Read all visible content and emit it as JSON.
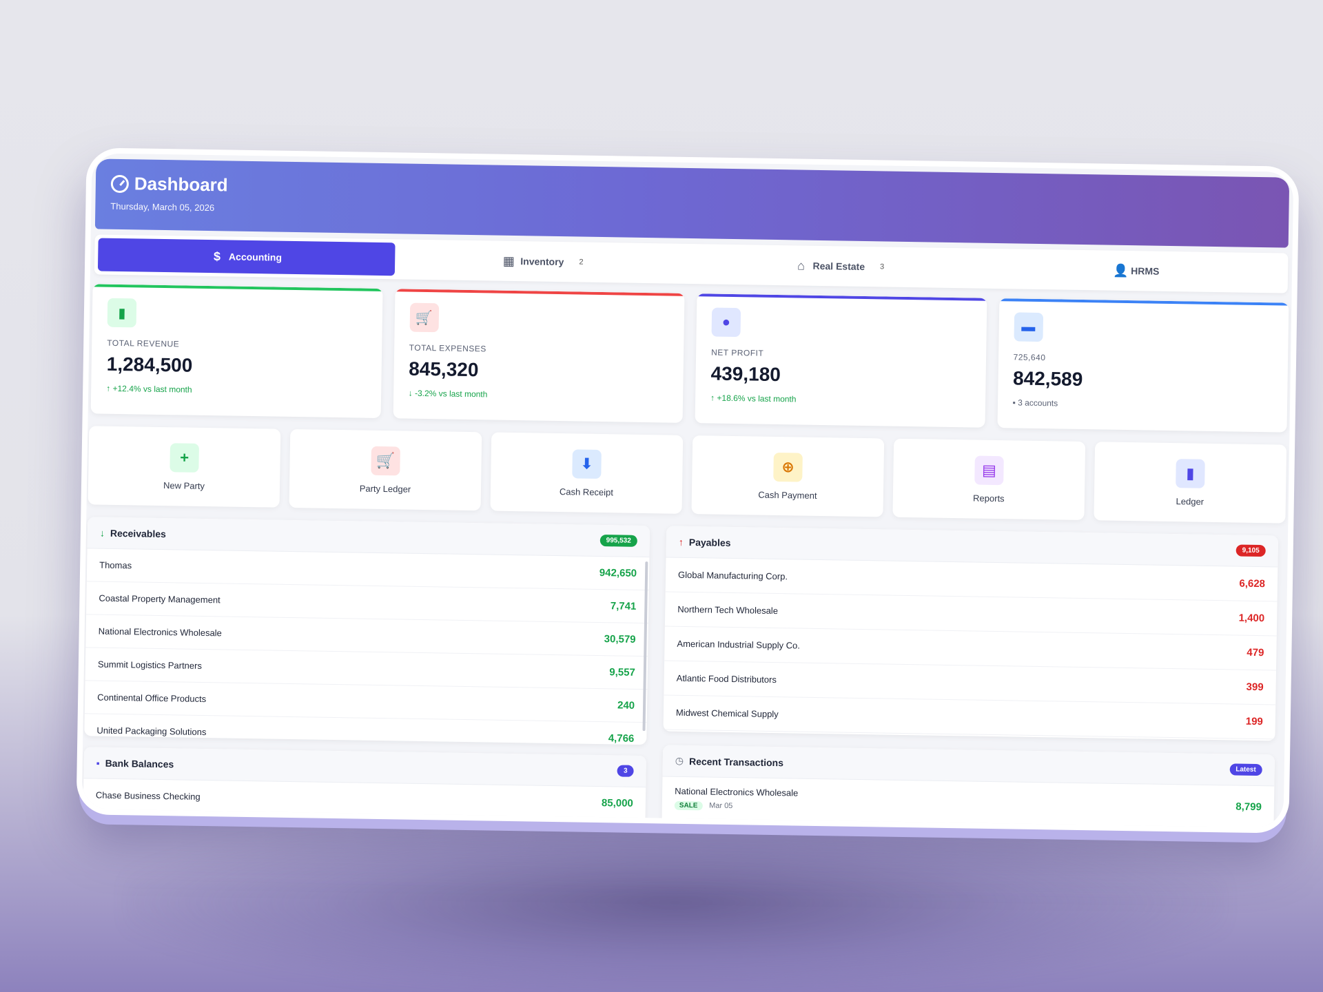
{
  "header": {
    "title": "Dashboard",
    "date": "Thursday, March 05, 2026"
  },
  "tabs": [
    {
      "label": "Accounting",
      "icon": "dollar-icon",
      "count": ""
    },
    {
      "label": "Inventory",
      "icon": "grid-icon",
      "count": "2"
    },
    {
      "label": "Real Estate",
      "icon": "home-icon",
      "count": "3"
    },
    {
      "label": "HRMS",
      "icon": "user-icon",
      "count": ""
    }
  ],
  "stats": [
    {
      "label": "TOTAL REVENUE",
      "value": "1,284,500",
      "trend": "+12.4% vs last month",
      "icon": "bar-chart-icon",
      "accent": "#22c55e"
    },
    {
      "label": "TOTAL EXPENSES",
      "value": "845,320",
      "trend": "-3.2% vs last month",
      "icon": "cart-icon",
      "accent": "#ef4444"
    },
    {
      "label": "NET PROFIT",
      "value": "439,180",
      "trend": "+18.6% vs last month",
      "icon": "piggy-bank-icon",
      "accent": "#4f46e5"
    },
    {
      "label": "725,640",
      "value": "842,589",
      "trend": "3 accounts",
      "icon": "credit-card-icon",
      "accent": "#3b82f6"
    }
  ],
  "actions": [
    {
      "label": "New Party",
      "icon": "plus-icon"
    },
    {
      "label": "Party Ledger",
      "icon": "cart-icon"
    },
    {
      "label": "Cash Receipt",
      "icon": "download-icon"
    },
    {
      "label": "Cash Payment",
      "icon": "coin-icon"
    },
    {
      "label": "Reports",
      "icon": "file-icon"
    },
    {
      "label": "Ledger",
      "icon": "book-icon"
    }
  ],
  "receivables": {
    "title": "Receivables",
    "total": "995,532",
    "rows": [
      {
        "name": "Thomas",
        "amount": "942,650"
      },
      {
        "name": "Coastal Property Management",
        "amount": "7,741"
      },
      {
        "name": "National Electronics Wholesale",
        "amount": "30,579"
      },
      {
        "name": "Summit Logistics Partners",
        "amount": "9,557"
      },
      {
        "name": "Continental Office Products",
        "amount": "240"
      },
      {
        "name": "United Packaging Solutions",
        "amount": "4,766"
      }
    ]
  },
  "payables": {
    "title": "Payables",
    "total": "9,105",
    "rows": [
      {
        "name": "Global Manufacturing Corp.",
        "amount": "6,628"
      },
      {
        "name": "Northern Tech Wholesale",
        "amount": "1,400"
      },
      {
        "name": "American Industrial Supply Co.",
        "amount": "479"
      },
      {
        "name": "Atlantic Food Distributors",
        "amount": "399"
      },
      {
        "name": "Midwest Chemical Supply",
        "amount": "199"
      }
    ]
  },
  "bank": {
    "title": "Bank Balances",
    "count": "3",
    "rows": [
      {
        "name": "Chase Business Checking",
        "amount": "85,000"
      }
    ]
  },
  "transactions": {
    "title": "Recent Transactions",
    "badge": "Latest",
    "rows": [
      {
        "name": "National Electronics Wholesale",
        "tag": "SALE",
        "date": "Mar 05",
        "amount": "8,799"
      }
    ]
  }
}
